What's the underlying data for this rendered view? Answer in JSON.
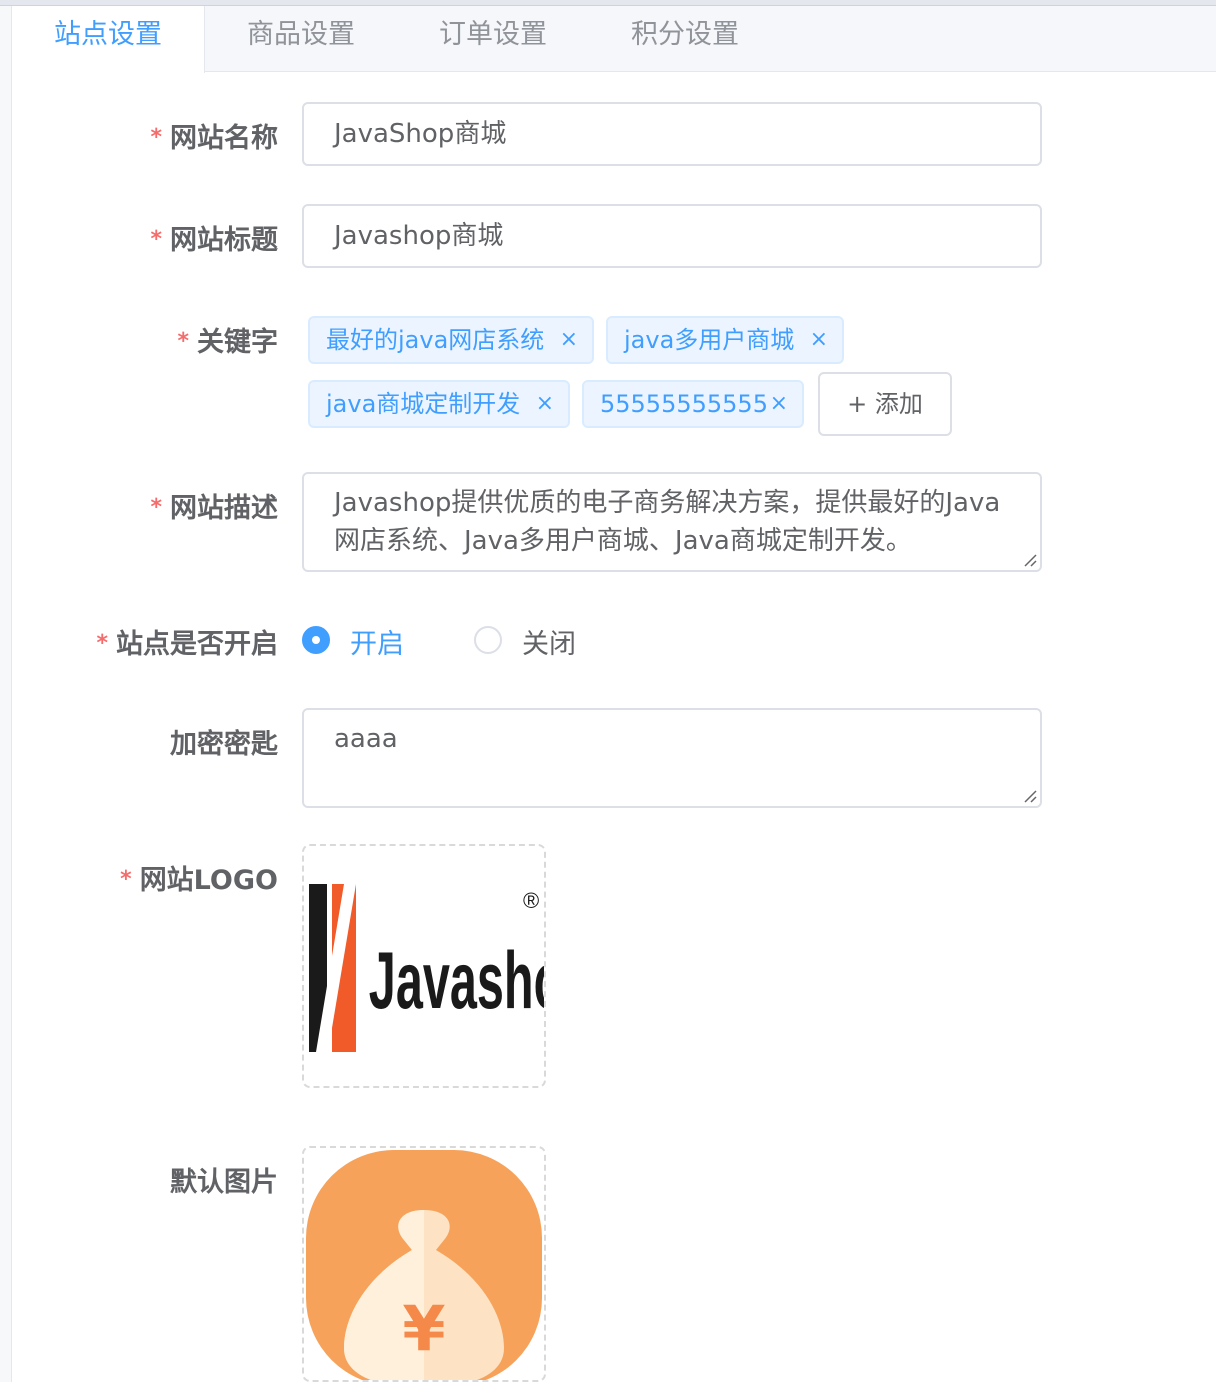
{
  "tabs": [
    {
      "label": "站点设置",
      "active": true
    },
    {
      "label": "商品设置",
      "active": false
    },
    {
      "label": "订单设置",
      "active": false
    },
    {
      "label": "积分设置",
      "active": false
    }
  ],
  "form": {
    "required_mark": "*",
    "site_name": {
      "label": "网站名称",
      "value": "JavaShop商城",
      "required": true
    },
    "site_title": {
      "label": "网站标题",
      "value": "Javashop商城",
      "required": true
    },
    "keywords": {
      "label": "关键字",
      "required": true,
      "tags": [
        "最好的java网店系统",
        "java多用户商城",
        "java商城定制开发",
        "55555555555"
      ],
      "add_label": "+ 添加"
    },
    "description": {
      "label": "网站描述",
      "required": true,
      "lines": [
        "Javashop提供优质的电子商务解决方案，提供最好的Java",
        "网店系统、Java多用户商城、Java商城定制开发。"
      ]
    },
    "site_open": {
      "label": "站点是否开启",
      "required": true,
      "options": [
        {
          "label": "开启",
          "checked": true
        },
        {
          "label": "关闭",
          "checked": false
        }
      ]
    },
    "encrypt_key": {
      "label": "加密密匙",
      "value": "aaaa",
      "required": false
    },
    "site_logo": {
      "label": "网站LOGO",
      "required": true,
      "logo_text": "Javashop",
      "registered_mark": "®"
    },
    "default_image": {
      "label": "默认图片",
      "required": false,
      "image_glyph": "¥"
    }
  },
  "colors": {
    "accent": "#409eff",
    "required": "#f56c6c",
    "tag_bg": "#ecf5ff",
    "logo_orange": "#f15a29",
    "money_orange": "#f7a25a"
  },
  "icons": {
    "tag_close": "×"
  }
}
